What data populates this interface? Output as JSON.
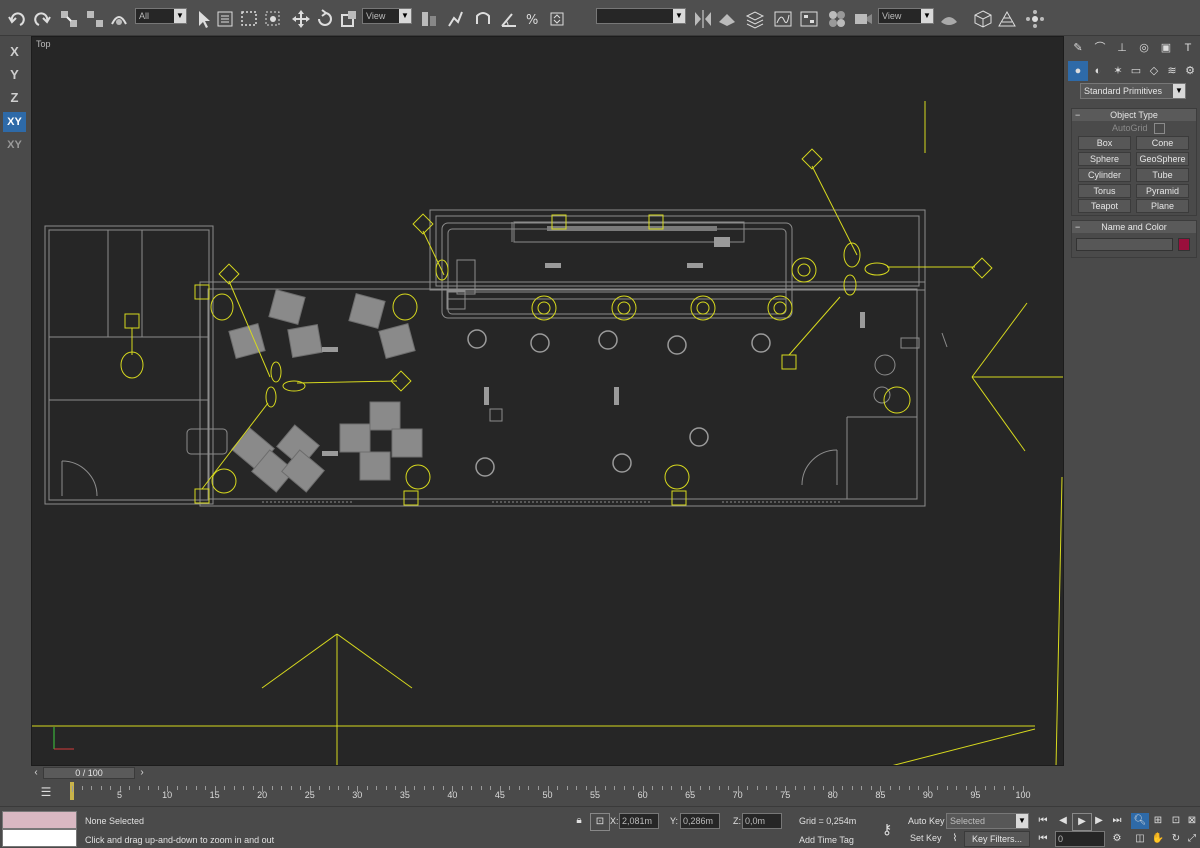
{
  "toolbar": {
    "selection_filter": "All",
    "ref_coord_1": "View",
    "named_selection": "",
    "ref_coord_2": "View",
    "icons": [
      "undo-icon",
      "redo-icon",
      "select-link-icon",
      "unlink-icon",
      "bind-spacewarp-icon",
      "select-object-icon",
      "select-by-name-icon",
      "rect-region-icon",
      "window-crossing-icon",
      "move-icon",
      "rotate-icon",
      "scale-icon",
      "pivot-icon",
      "select-manipulate-icon",
      "snap-2d-icon",
      "angle-snap-icon",
      "percent-snap-icon",
      "spinner-snap-icon",
      "mirror-icon",
      "align-icon",
      "layer-manager-icon",
      "curve-editor-icon",
      "schematic-icon",
      "material-editor-icon",
      "render-setup-icon",
      "render-icon",
      "quick-render-icon"
    ]
  },
  "axisbar": {
    "x": "X",
    "y": "Y",
    "z": "Z",
    "xy": "XY",
    "xy_alt": "XY"
  },
  "viewport": {
    "label": "Top"
  },
  "command_panel": {
    "category_dropdown": "Standard Primitives",
    "object_type": {
      "header": "Object Type",
      "autogrid": "AutoGrid",
      "buttons": [
        "Box",
        "Cone",
        "Sphere",
        "GeoSphere",
        "Cylinder",
        "Tube",
        "Torus",
        "Pyramid",
        "Teapot",
        "Plane"
      ]
    },
    "name_color": {
      "header": "Name and Color",
      "name_value": "",
      "swatch_color": "#9a0f3c"
    }
  },
  "time_slider": {
    "position": "0 / 100",
    "current_frame": 0,
    "total_frames": 100
  },
  "timeline": {
    "labels": [
      "5",
      "10",
      "15",
      "20",
      "25",
      "30",
      "35",
      "40",
      "45",
      "50",
      "55",
      "60",
      "65",
      "70",
      "75",
      "80",
      "85",
      "90",
      "95",
      "100"
    ]
  },
  "status": {
    "selection": "None Selected",
    "prompt": "Click and drag up-and-down to zoom in and out",
    "x_label": "X:",
    "x_value": "2,081m",
    "y_label": "Y:",
    "y_value": "0,286m",
    "z_label": "Z:",
    "z_value": "0,0m",
    "grid": "Grid = 0,254m",
    "add_time_tag": "Add Time Tag",
    "auto_key": "Auto Key",
    "set_key": "Set Key",
    "selected": "Selected",
    "key_filters": "Key Filters...",
    "frame": "0"
  },
  "colors": {
    "wire": "#d7d91e",
    "furniture": "#8a8a8a",
    "walls": "#8c8c8c",
    "viewport_bg": "#262626",
    "panel_bg": "#4a4a4a"
  }
}
